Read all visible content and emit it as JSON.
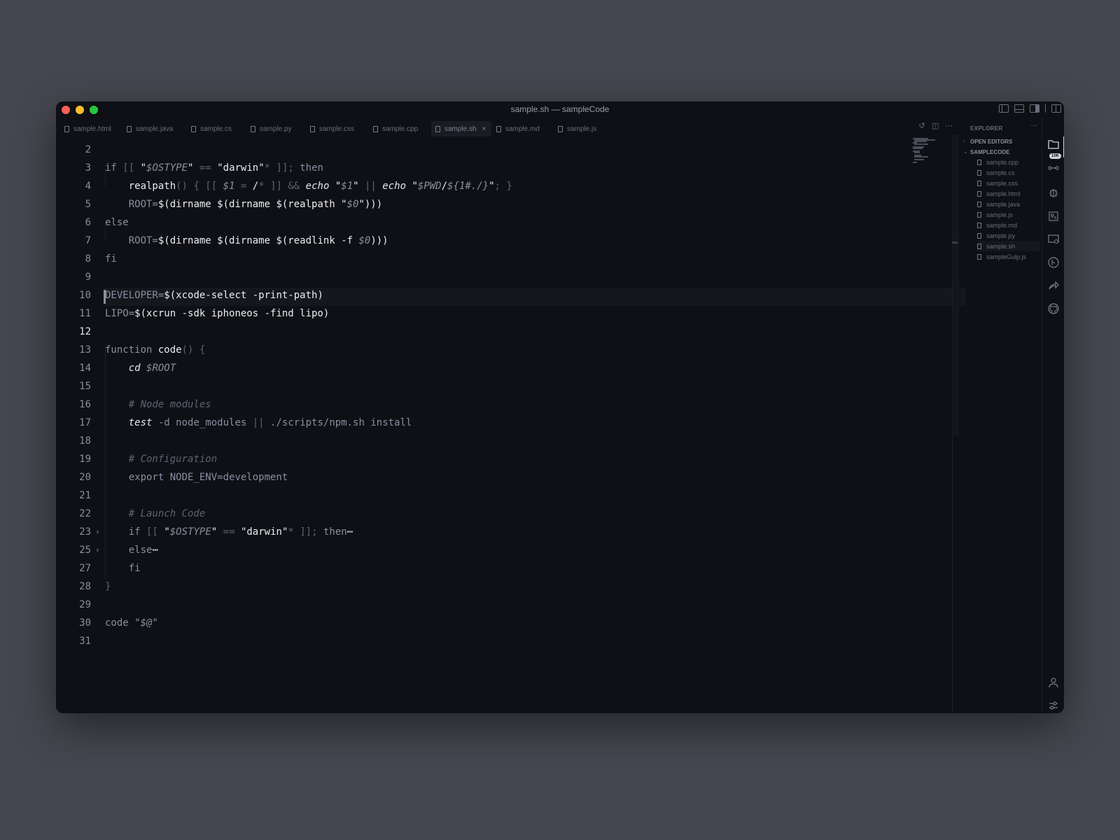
{
  "window": {
    "title": "sample.sh — sampleCode"
  },
  "tabs": [
    {
      "label": "sample.html"
    },
    {
      "label": "sample.java"
    },
    {
      "label": "sample.cs"
    },
    {
      "label": "sample.py"
    },
    {
      "label": "sample.css"
    },
    {
      "label": "sample.cpp"
    },
    {
      "label": "sample.sh",
      "active": true,
      "close": "×"
    },
    {
      "label": "sample.md"
    },
    {
      "label": "sample.js"
    }
  ],
  "editor": {
    "line_numbers": [
      "2",
      "3",
      "4",
      "5",
      "6",
      "7",
      "8",
      "9",
      "10",
      "11",
      "12",
      "13",
      "14",
      "15",
      "16",
      "17",
      "18",
      "19",
      "20",
      "21",
      "22",
      "23",
      "25",
      "27",
      "28",
      "29",
      "30",
      "31"
    ],
    "current_line": "12",
    "fold_markers": {
      "23": "›",
      "25": "›"
    }
  },
  "sidebar": {
    "title": "EXPLORER",
    "more": "···",
    "open_editors": "OPEN EDITORS",
    "folder": "SAMPLECODE",
    "files": [
      "sample.cpp",
      "sample.cs",
      "sample.css",
      "sample.html",
      "sample.java",
      "sample.js",
      "sample.md",
      "sample.py",
      "sample.sh",
      "sampleGulp.js"
    ],
    "active_file": "sample.sh"
  },
  "activity_bar": {
    "badge": "10K",
    "icons": [
      "files-icon",
      "source-control-icon",
      "debug-icon",
      "extensions-icon",
      "remote-explorer-icon",
      "git-graph-icon",
      "live-share-icon",
      "github-icon",
      "account-icon",
      "settings-icon"
    ]
  },
  "colors": {
    "background": "#0e1015",
    "desktop": "#45464f",
    "accent": "#d4d5db"
  }
}
